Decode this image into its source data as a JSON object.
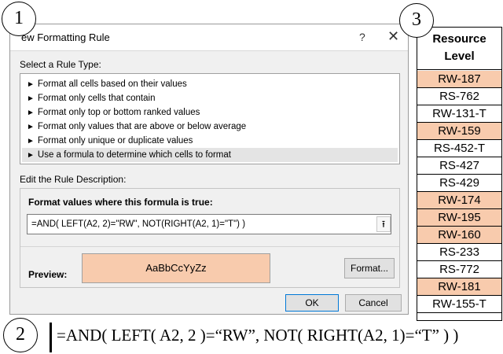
{
  "colors": {
    "highlight": "#f8cbad",
    "dialog_bg": "#f0f0f0",
    "selected_item": "#e4e4e4"
  },
  "callouts": {
    "one": "1",
    "two": "2",
    "three": "3"
  },
  "dialog": {
    "title": "ew Formatting Rule",
    "help": "?",
    "close": "✕",
    "select_rule_label": "Select a Rule Type:",
    "rule_types": [
      "Format all cells based on their values",
      "Format only cells that contain",
      "Format only top or bottom ranked values",
      "Format only values that are above or below average",
      "Format only unique or duplicate values",
      "Use a formula to determine which cells to format"
    ],
    "selected_rule_index": 5,
    "edit_label": "Edit the Rule Description:",
    "formula_label": "Format values where this formula is true:",
    "formula_value": "=AND( LEFT(A2, 2)=\"RW\", NOT(RIGHT(A2, 1)=\"T\") )",
    "formula_btn_icon": "collapse-arrow-icon",
    "preview_label": "Preview:",
    "preview_text": "AaBbCcYyZz",
    "format_button": "Format...",
    "ok_button": "OK",
    "cancel_button": "Cancel"
  },
  "sheet": {
    "header": "Resource Level",
    "rows": [
      {
        "value": "RW-187",
        "highlight": true
      },
      {
        "value": "RS-762",
        "highlight": false
      },
      {
        "value": "RW-131-T",
        "highlight": false
      },
      {
        "value": "RW-159",
        "highlight": true
      },
      {
        "value": "RS-452-T",
        "highlight": false
      },
      {
        "value": "RS-427",
        "highlight": false
      },
      {
        "value": "RS-429",
        "highlight": false
      },
      {
        "value": "RW-174",
        "highlight": true
      },
      {
        "value": "RW-195",
        "highlight": true
      },
      {
        "value": "RW-160",
        "highlight": true
      },
      {
        "value": "RS-233",
        "highlight": false
      },
      {
        "value": "RS-772",
        "highlight": false
      },
      {
        "value": "RW-181",
        "highlight": true
      },
      {
        "value": "RW-155-T",
        "highlight": false
      }
    ]
  },
  "bottom_formula": "=AND( LEFT( A2, 2 )=“RW”, NOT( RIGHT(A2, 1)=“T” ) )"
}
